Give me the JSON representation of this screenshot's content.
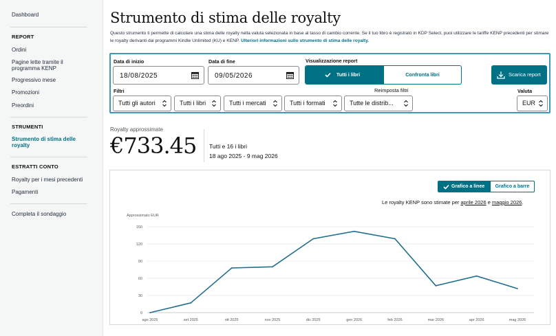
{
  "sidebar": {
    "dashboard": "Dashboard",
    "report_heading": "REPORT",
    "report_items": [
      "Ordini",
      "Pagine lette tramite il",
      "programma KENP",
      "Progressivo mese",
      "Promozioni",
      "Preordini"
    ],
    "tools_heading": "STRUMENTI",
    "tools_active_line1": "Strumento di stima delle",
    "tools_active_line2": "royalty",
    "statements_heading": "ESTRATTI CONTO",
    "statements_items": [
      "Royalty per i mesi precedenti",
      "Pagamenti"
    ],
    "survey": "Completa il sondaggio"
  },
  "page": {
    "title": "Strumento di stima delle royalty",
    "intro": "Questo strumento ti permette di calcolare una stima delle royalty nella valuta selezionata in base al tasso di cambio corrente. Se il tuo libro è registrato in KDP Select, puoi utilizzare le tariffe KENP precedenti per stimare le royalty derivanti dai programmi Kindle Unlimited (KU) e KENP.",
    "intro_link": "Ulteriori informazioni sullo strumento di stima delle royalty."
  },
  "filters": {
    "start_label": "Data di inizio",
    "start_value": "18/08/2025",
    "end_label": "Data di fine",
    "end_value": "09/05/2026",
    "view_label": "Visualizzazione report",
    "view_all": "Tutti i libri",
    "view_compare": "Confronta libri",
    "download": "Scarica report",
    "filters_label": "Filtri",
    "reset": "Reimposta filtri",
    "currency_label": "Valuta",
    "authors": "Tutti gli autori",
    "books": "Tutti i libri",
    "markets": "Tutti i mercati",
    "formats": "Tutti i formati",
    "distribution": "Tutte le distrib...",
    "currency": "EUR"
  },
  "summary": {
    "label": "Royalty approssimate",
    "amount": "€733.45",
    "books": "Tutti e 16 i libri",
    "range": "18 ago 2025 - 9 mag 2026"
  },
  "chart_toggle": {
    "line": "Grafico a linee",
    "bar": "Grafico a barre"
  },
  "kenp_note": {
    "prefix": "Le royalty KENP sono stimate per ",
    "month1": "aprile 2026",
    "middle": " e ",
    "month2": "maggio 2026",
    "suffix": "."
  },
  "colors": {
    "accent": "#007185",
    "line": "#1f6e8c"
  },
  "chart_data": {
    "type": "line",
    "ylabel": "Approssimato EUR",
    "categories": [
      "ago 2025",
      "set 2025",
      "ott 2025",
      "nov 2025",
      "dic 2025",
      "gen 2026",
      "feb 2026",
      "mar 2026",
      "apr 2026",
      "mag 2026"
    ],
    "values": [
      0,
      17,
      78,
      80,
      129,
      142,
      129,
      47,
      64,
      42
    ],
    "yticks": [
      0,
      30,
      60,
      90,
      120,
      150
    ],
    "ylim": [
      0,
      150
    ],
    "grid": true
  }
}
